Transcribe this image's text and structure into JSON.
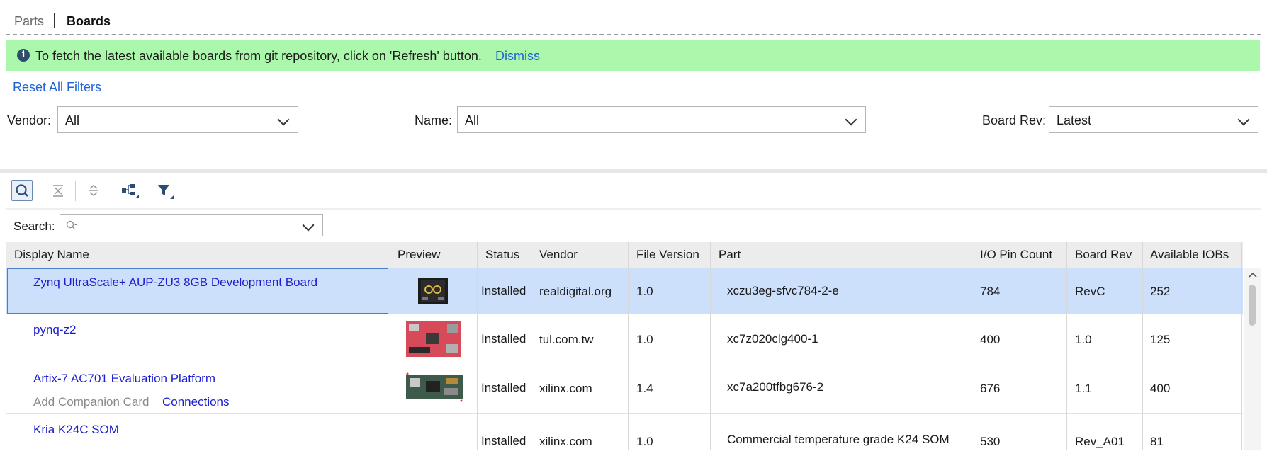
{
  "tabs": {
    "parts": "Parts",
    "boards": "Boards"
  },
  "banner": {
    "message": "To fetch the latest available boards from git repository, click on 'Refresh' button.",
    "dismiss": "Dismiss",
    "icon": "i"
  },
  "filters": {
    "reset": "Reset All Filters",
    "vendor_label": "Vendor:",
    "vendor_value": "All",
    "name_label": "Name:",
    "name_value": "All",
    "board_rev_label": "Board Rev:",
    "board_rev_value": "Latest"
  },
  "search": {
    "label": "Search:",
    "placeholder": "Q-"
  },
  "table": {
    "columns": [
      "Display Name",
      "Preview",
      "Status",
      "Vendor",
      "File Version",
      "Part",
      "I/O Pin Count",
      "Board Rev",
      "Available IOBs"
    ],
    "rows": [
      {
        "name": "Zynq UltraScale+ AUP-ZU3 8GB Development Board",
        "status": "Installed",
        "vendor": "realdigital.org",
        "file_version": "1.0",
        "part": "xczu3eg-sfvc784-2-e",
        "io_pin_count": "784",
        "board_rev": "RevC",
        "available_iobs": "252"
      },
      {
        "name": "pynq-z2",
        "status": "Installed",
        "vendor": "tul.com.tw",
        "file_version": "1.0",
        "part": "xc7z020clg400-1",
        "io_pin_count": "400",
        "board_rev": "1.0",
        "available_iobs": "125"
      },
      {
        "name": "Artix-7 AC701 Evaluation Platform",
        "sub_add": "Add Companion Card",
        "sub_conn": "Connections",
        "status": "Installed",
        "vendor": "xilinx.com",
        "file_version": "1.4",
        "part": "xc7a200tfbg676-2",
        "io_pin_count": "676",
        "board_rev": "1.1",
        "available_iobs": "400"
      },
      {
        "name": "Kria K24C SOM",
        "status": "Installed",
        "vendor": "xilinx.com",
        "file_version": "1.0",
        "part": "Commercial temperature grade K24 SOM",
        "io_pin_count": "530",
        "board_rev": "Rev_A01",
        "available_iobs": "81"
      }
    ]
  },
  "colors": {
    "banner_bg": "#abf7ab",
    "link": "#2065d1",
    "selected_row": "#cde0fb",
    "name_link": "#1c1fd0"
  },
  "icons": [
    "info-icon",
    "search-icon",
    "collapse-all-icon",
    "expand-all-icon",
    "hierarchy-icon",
    "filter-icon",
    "chevron-down-icon"
  ]
}
